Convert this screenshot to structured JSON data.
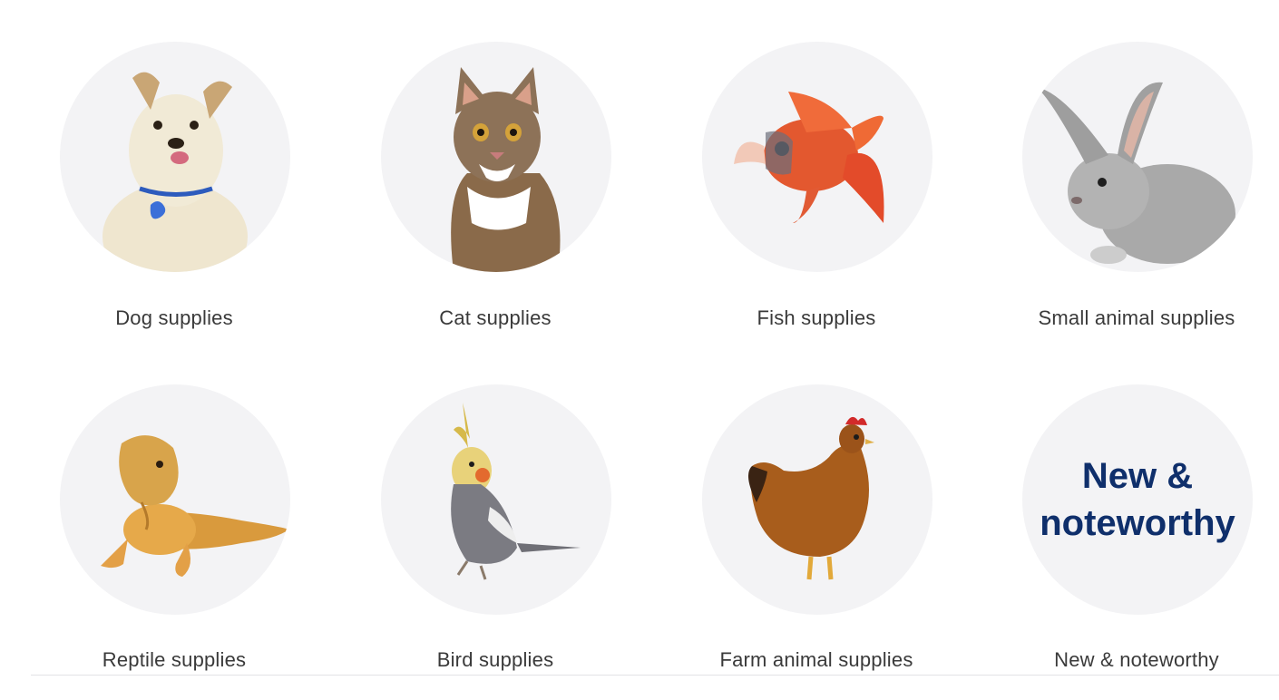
{
  "categories": [
    {
      "label": "Dog supplies",
      "image": "dog-photo"
    },
    {
      "label": "Cat supplies",
      "image": "cat-photo"
    },
    {
      "label": "Fish supplies",
      "image": "fish-photo"
    },
    {
      "label": "Small animal supplies",
      "image": "rabbit-photo"
    },
    {
      "label": "Reptile supplies",
      "image": "lizard-photo"
    },
    {
      "label": "Bird supplies",
      "image": "cockatiel-photo"
    },
    {
      "label": "Farm animal supplies",
      "image": "chicken-photo"
    },
    {
      "label": "New & noteworthy",
      "image": "text-tile"
    }
  ],
  "new_tile": {
    "line1": "New &",
    "line2": "noteworthy"
  },
  "colors": {
    "circle_bg": "#f3f3f5",
    "label_text": "#3a3a3a",
    "new_tile_text": "#0f2f6b"
  }
}
